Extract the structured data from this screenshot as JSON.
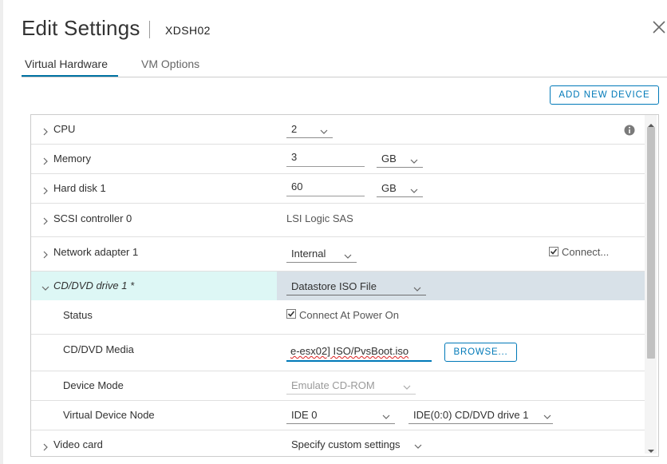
{
  "dialog": {
    "title": "Edit Settings",
    "vm_name": "XDSH02"
  },
  "tabs": [
    {
      "label": "Virtual Hardware",
      "active": true
    },
    {
      "label": "VM Options",
      "active": false
    }
  ],
  "toolbar": {
    "add_new_device": "ADD NEW DEVICE"
  },
  "hardware": {
    "cpu": {
      "label": "CPU",
      "value": "2"
    },
    "memory": {
      "label": "Memory",
      "value": "3",
      "unit": "GB"
    },
    "hard_disk": {
      "label": "Hard disk 1",
      "value": "60",
      "unit": "GB"
    },
    "scsi": {
      "label": "SCSI controller 0",
      "value": "LSI Logic SAS"
    },
    "network": {
      "label": "Network adapter 1",
      "value": "Internal",
      "connect_label": "Connect...",
      "connected": true
    },
    "cdrom": {
      "label": "CD/DVD drive 1 *",
      "value": "Datastore ISO File",
      "status_label": "Status",
      "status_value": "Connect At Power On",
      "status_checked": true,
      "media_label": "CD/DVD Media",
      "media_value": "e-esx02] ISO/PvsBoot.iso",
      "browse": "BROWSE...",
      "device_mode_label": "Device Mode",
      "device_mode_value": "Emulate CD-ROM",
      "node_label": "Virtual Device Node",
      "node_bus": "IDE 0",
      "node_device": "IDE(0:0) CD/DVD drive 1"
    },
    "video": {
      "label": "Video card",
      "value": "Specify custom settings"
    }
  },
  "colors": {
    "accent": "#0079b8",
    "expanded_row_left": "#ddf7f5",
    "expanded_row_right": "#d8e1e8"
  }
}
